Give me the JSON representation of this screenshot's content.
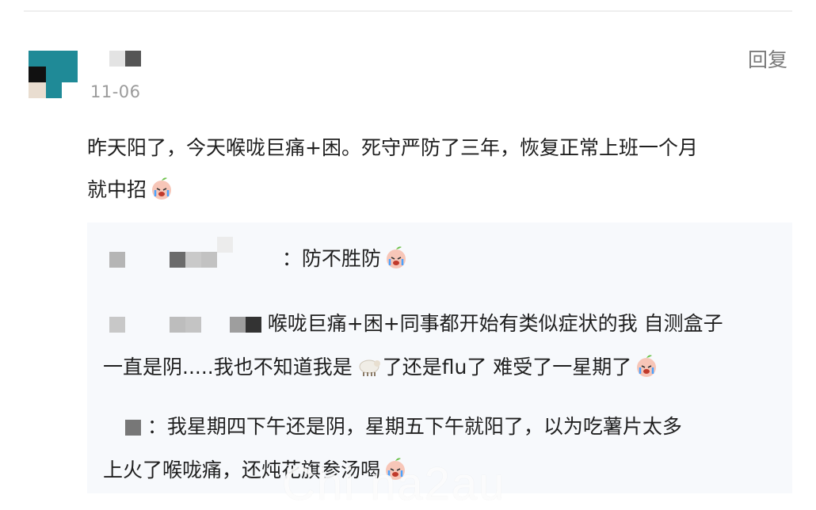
{
  "comment": {
    "date": "11-06",
    "reply_label": "回复",
    "text_line1": "昨天阳了，今天喉咙巨痛+困。死守严防了三年，恢复正常上班一个月",
    "text_line2": "就中招"
  },
  "replies": [
    {
      "text": "：防不胜防"
    },
    {
      "text_line1": "喉咙巨痛+困+同事都开始有类似症状的我 自测盒子",
      "text_line2a": "一直是阴.....我也不知道我是",
      "text_line2b": "了还是flu了 难受了一星期了"
    },
    {
      "text_line1": "：我星期四下午还是阴，星期五下午就阳了，以为吃薯片太多",
      "text_line2": "上火了喉咙痛，还炖花旗参汤喝"
    }
  ],
  "watermark": "Chi na2au",
  "icons": {
    "cry": "crying-face-icon",
    "sheep": "sheep-icon"
  }
}
